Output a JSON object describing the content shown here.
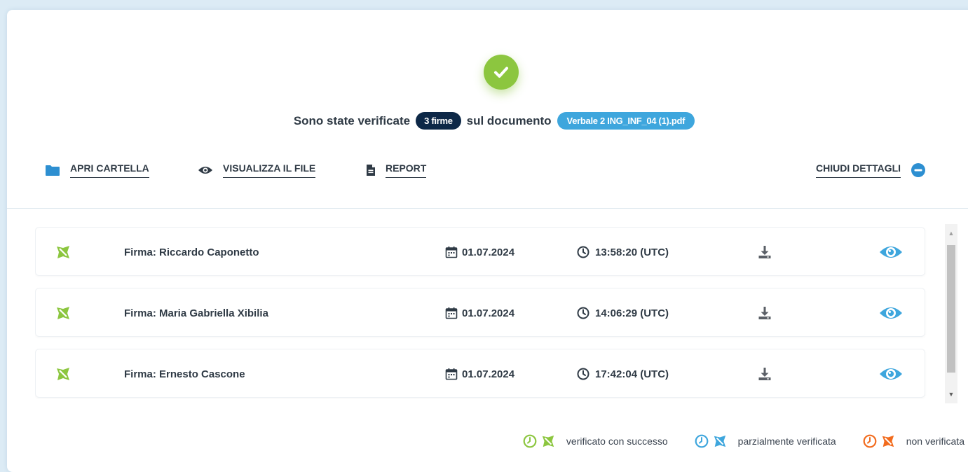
{
  "header": {
    "text_before": "Sono state verificate",
    "count_badge": "3 firme",
    "text_middle": "sul documento",
    "file_badge": "Verbale 2 ING_INF_04 (1).pdf"
  },
  "toolbar": {
    "open_folder": "APRI CARTELLA",
    "view_file": "VISUALIZZA IL FILE",
    "report": "REPORT",
    "close_details": "CHIUDI DETTAGLI"
  },
  "signatures": [
    {
      "name": "Firma: Riccardo Caponetto",
      "date": "01.07.2024",
      "time": "13:58:20 (UTC)",
      "status": "verified"
    },
    {
      "name": "Firma: Maria Gabriella Xibilia",
      "date": "01.07.2024",
      "time": "14:06:29 (UTC)",
      "status": "verified"
    },
    {
      "name": "Firma: Ernesto Cascone",
      "date": "01.07.2024",
      "time": "17:42:04 (UTC)",
      "status": "verified"
    }
  ],
  "legend": {
    "verified": "verificato con successo",
    "partial": "parzialmente verificata",
    "failed": "non verificata"
  },
  "colors": {
    "verified": "#8cc63f",
    "partial": "#3ea6dd",
    "failed": "#f26b1d",
    "navy": "#0d2847",
    "accent_blue": "#3ea6dd"
  }
}
